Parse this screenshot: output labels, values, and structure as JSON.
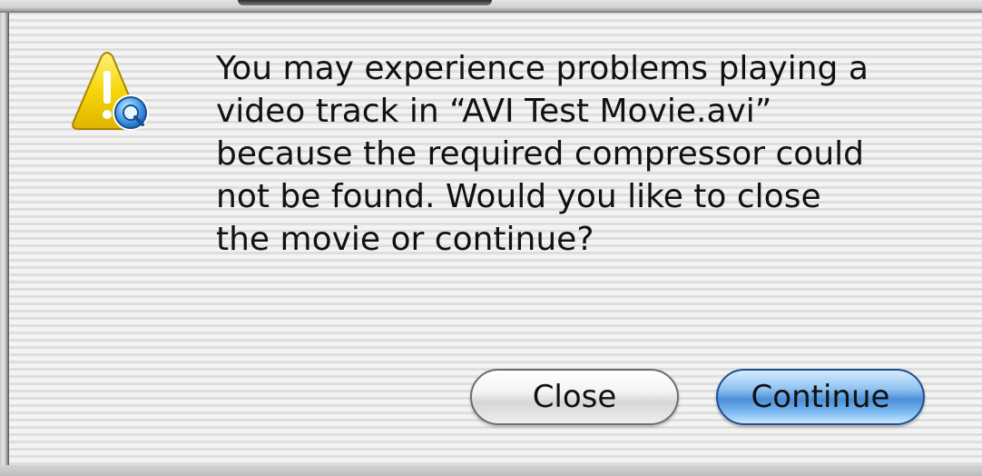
{
  "dialog": {
    "message": "You may experience problems playing a\nvideo track in “AVI Test Movie.avi”\nbecause the required compressor could\nnot be found. Would you like to close\nthe movie or continue?",
    "icon": "quicktime-warning-icon"
  },
  "buttons": {
    "close_label": "Close",
    "continue_label": "Continue"
  },
  "colors": {
    "warning_yellow": "#f5d60a",
    "default_button_blue": "#4b8fd8"
  }
}
